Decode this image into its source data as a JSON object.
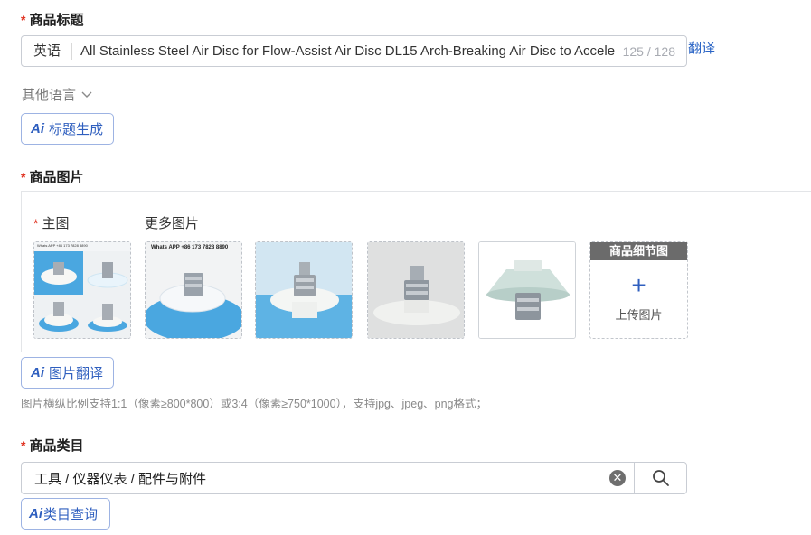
{
  "title_section": {
    "required_mark": "*",
    "label": "商品标题",
    "lang_prefix": "英语",
    "value": "All Stainless Steel Air Disc for Flow-Assist Air Disc DL15 Arch-Breaking Air Disc to Accele",
    "count": "125 / 128",
    "translate_link": "翻译",
    "other_lang": "其他语言",
    "ai_button": "标题生成"
  },
  "image_section": {
    "required_mark": "*",
    "label": "商品图片",
    "main_label_mark": "*",
    "main_label": "主图",
    "more_label": "更多图片",
    "thumb1_caption": "Whats APP +86 173 7828 8890",
    "thumb2_caption": "Whats APP +86 173 7828 8890",
    "detail_title": "商品细节图",
    "upload_plus": "+",
    "upload_text": "上传图片",
    "ai_button": "图片翻译",
    "hint": "图片横纵比例支持1:1（像素≥800*800）或3:4（像素≥750*1000），支持jpg、jpeg、png格式；"
  },
  "category_section": {
    "required_mark": "*",
    "label": "商品类目",
    "value": "工具 / 仪器仪表 / 配件与附件",
    "clear_symbol": "✕",
    "ai_button": "类目查询"
  },
  "ai_mark": "Ai",
  "colors": {
    "accent": "#2f5fbf",
    "required": "#e0301e",
    "border": "#c9cdd4"
  }
}
